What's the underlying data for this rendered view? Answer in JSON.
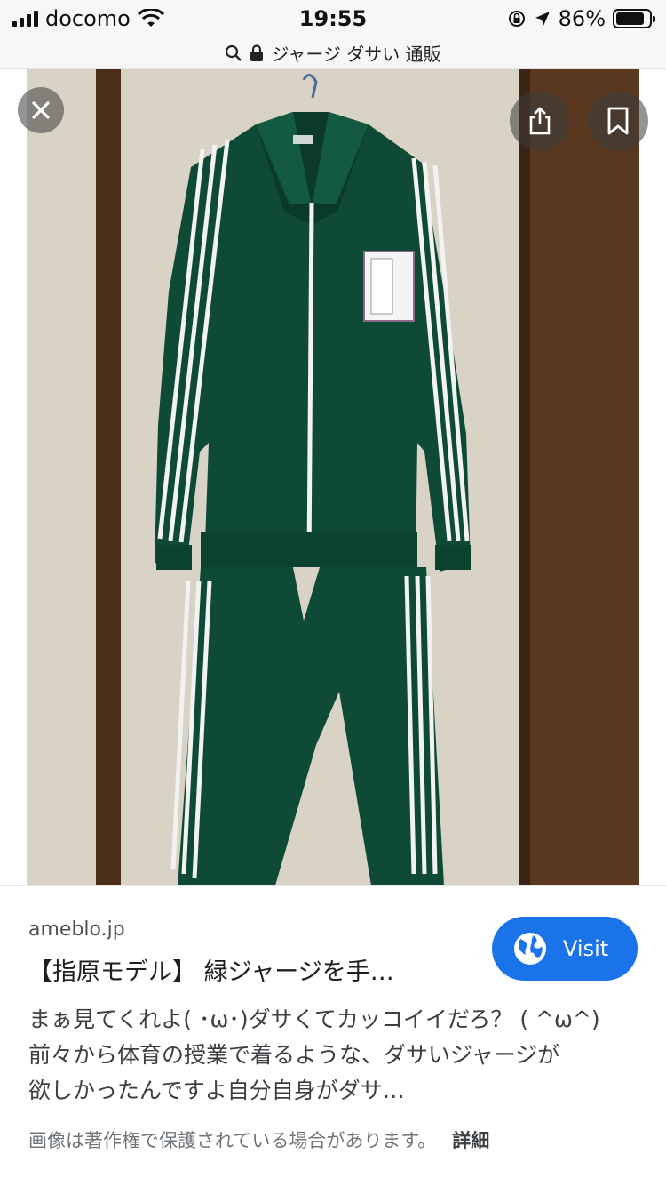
{
  "status_bar": {
    "carrier": "docomo",
    "time": "19:55",
    "battery_percent": "86%",
    "battery_level": 0.86
  },
  "url_bar": {
    "query": "ジャージ ダサい 通販"
  },
  "viewer": {
    "close_icon": "close-icon",
    "share_icon": "share-icon",
    "bookmark_icon": "bookmark-icon",
    "image_alt": "green track suit jacket and pants with white stripes hanging on a door",
    "colors": {
      "suit": "#0f4a36",
      "stripe": "#f2f2f2",
      "door_frame": "#4a2e1a",
      "wall": "#d8d2c4"
    }
  },
  "result": {
    "domain": "ameblo.jp",
    "title": "【指原モデル】 緑ジャージを手…",
    "visit_label": "Visit",
    "description_lines": [
      "まぁ見てくれよ( ･ω･)ダサくてカッコイイだろ？ ( ^ω^)",
      "前々から体育の授業で着るような、ダサいジャージが",
      "欲しかったんですよ自分自身がダサ…"
    ],
    "copyright_notice": "画像は著作権で保護されている場合があります。",
    "details_label": "詳細",
    "accent_color": "#1a73e8"
  }
}
